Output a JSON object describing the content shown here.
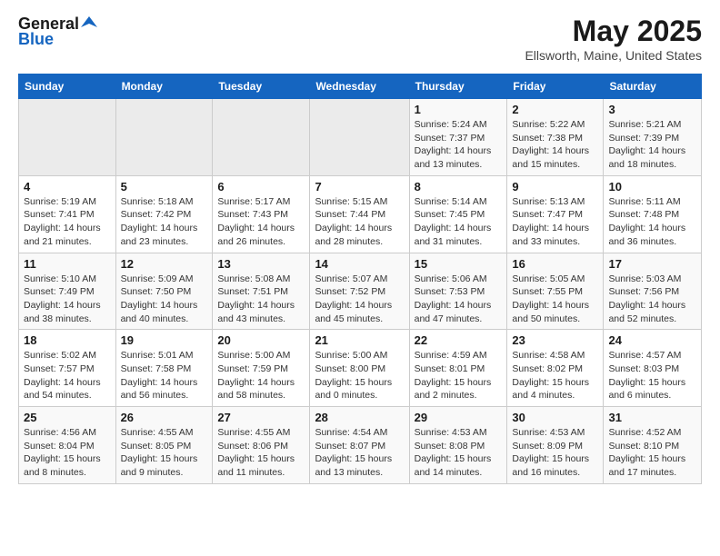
{
  "header": {
    "logo_general": "General",
    "logo_blue": "Blue",
    "title": "May 2025",
    "location": "Ellsworth, Maine, United States"
  },
  "days_of_week": [
    "Sunday",
    "Monday",
    "Tuesday",
    "Wednesday",
    "Thursday",
    "Friday",
    "Saturday"
  ],
  "weeks": [
    [
      {
        "day": "",
        "empty": true
      },
      {
        "day": "",
        "empty": true
      },
      {
        "day": "",
        "empty": true
      },
      {
        "day": "",
        "empty": true
      },
      {
        "day": "1",
        "sunrise": "5:24 AM",
        "sunset": "7:37 PM",
        "daylight": "14 hours and 13 minutes."
      },
      {
        "day": "2",
        "sunrise": "5:22 AM",
        "sunset": "7:38 PM",
        "daylight": "14 hours and 15 minutes."
      },
      {
        "day": "3",
        "sunrise": "5:21 AM",
        "sunset": "7:39 PM",
        "daylight": "14 hours and 18 minutes."
      }
    ],
    [
      {
        "day": "4",
        "sunrise": "5:19 AM",
        "sunset": "7:41 PM",
        "daylight": "14 hours and 21 minutes."
      },
      {
        "day": "5",
        "sunrise": "5:18 AM",
        "sunset": "7:42 PM",
        "daylight": "14 hours and 23 minutes."
      },
      {
        "day": "6",
        "sunrise": "5:17 AM",
        "sunset": "7:43 PM",
        "daylight": "14 hours and 26 minutes."
      },
      {
        "day": "7",
        "sunrise": "5:15 AM",
        "sunset": "7:44 PM",
        "daylight": "14 hours and 28 minutes."
      },
      {
        "day": "8",
        "sunrise": "5:14 AM",
        "sunset": "7:45 PM",
        "daylight": "14 hours and 31 minutes."
      },
      {
        "day": "9",
        "sunrise": "5:13 AM",
        "sunset": "7:47 PM",
        "daylight": "14 hours and 33 minutes."
      },
      {
        "day": "10",
        "sunrise": "5:11 AM",
        "sunset": "7:48 PM",
        "daylight": "14 hours and 36 minutes."
      }
    ],
    [
      {
        "day": "11",
        "sunrise": "5:10 AM",
        "sunset": "7:49 PM",
        "daylight": "14 hours and 38 minutes."
      },
      {
        "day": "12",
        "sunrise": "5:09 AM",
        "sunset": "7:50 PM",
        "daylight": "14 hours and 40 minutes."
      },
      {
        "day": "13",
        "sunrise": "5:08 AM",
        "sunset": "7:51 PM",
        "daylight": "14 hours and 43 minutes."
      },
      {
        "day": "14",
        "sunrise": "5:07 AM",
        "sunset": "7:52 PM",
        "daylight": "14 hours and 45 minutes."
      },
      {
        "day": "15",
        "sunrise": "5:06 AM",
        "sunset": "7:53 PM",
        "daylight": "14 hours and 47 minutes."
      },
      {
        "day": "16",
        "sunrise": "5:05 AM",
        "sunset": "7:55 PM",
        "daylight": "14 hours and 50 minutes."
      },
      {
        "day": "17",
        "sunrise": "5:03 AM",
        "sunset": "7:56 PM",
        "daylight": "14 hours and 52 minutes."
      }
    ],
    [
      {
        "day": "18",
        "sunrise": "5:02 AM",
        "sunset": "7:57 PM",
        "daylight": "14 hours and 54 minutes."
      },
      {
        "day": "19",
        "sunrise": "5:01 AM",
        "sunset": "7:58 PM",
        "daylight": "14 hours and 56 minutes."
      },
      {
        "day": "20",
        "sunrise": "5:00 AM",
        "sunset": "7:59 PM",
        "daylight": "14 hours and 58 minutes."
      },
      {
        "day": "21",
        "sunrise": "5:00 AM",
        "sunset": "8:00 PM",
        "daylight": "15 hours and 0 minutes."
      },
      {
        "day": "22",
        "sunrise": "4:59 AM",
        "sunset": "8:01 PM",
        "daylight": "15 hours and 2 minutes."
      },
      {
        "day": "23",
        "sunrise": "4:58 AM",
        "sunset": "8:02 PM",
        "daylight": "15 hours and 4 minutes."
      },
      {
        "day": "24",
        "sunrise": "4:57 AM",
        "sunset": "8:03 PM",
        "daylight": "15 hours and 6 minutes."
      }
    ],
    [
      {
        "day": "25",
        "sunrise": "4:56 AM",
        "sunset": "8:04 PM",
        "daylight": "15 hours and 8 minutes."
      },
      {
        "day": "26",
        "sunrise": "4:55 AM",
        "sunset": "8:05 PM",
        "daylight": "15 hours and 9 minutes."
      },
      {
        "day": "27",
        "sunrise": "4:55 AM",
        "sunset": "8:06 PM",
        "daylight": "15 hours and 11 minutes."
      },
      {
        "day": "28",
        "sunrise": "4:54 AM",
        "sunset": "8:07 PM",
        "daylight": "15 hours and 13 minutes."
      },
      {
        "day": "29",
        "sunrise": "4:53 AM",
        "sunset": "8:08 PM",
        "daylight": "15 hours and 14 minutes."
      },
      {
        "day": "30",
        "sunrise": "4:53 AM",
        "sunset": "8:09 PM",
        "daylight": "15 hours and 16 minutes."
      },
      {
        "day": "31",
        "sunrise": "4:52 AM",
        "sunset": "8:10 PM",
        "daylight": "15 hours and 17 minutes."
      }
    ]
  ],
  "labels": {
    "sunrise": "Sunrise:",
    "sunset": "Sunset:",
    "daylight": "Daylight:"
  }
}
